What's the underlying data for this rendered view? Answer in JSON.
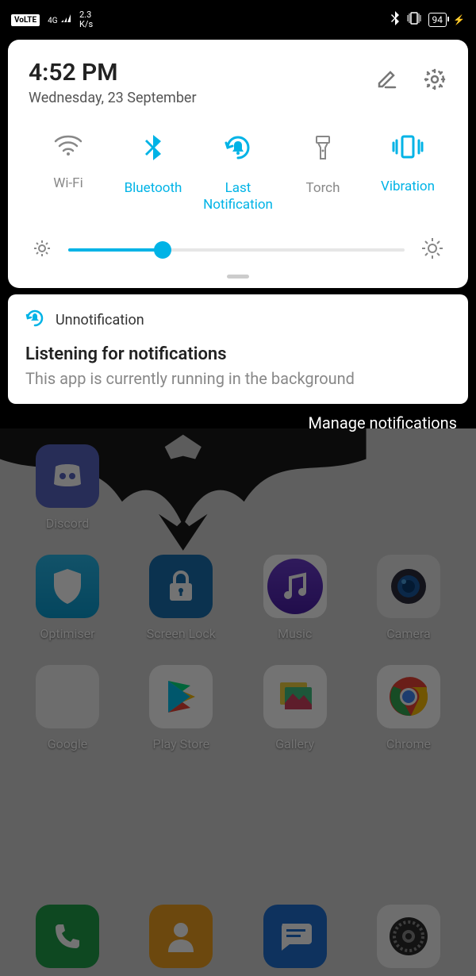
{
  "status": {
    "volte": "VoLTE",
    "network": "4G",
    "speed_top": "2.3",
    "speed_bottom": "K/s",
    "battery": "94"
  },
  "qs": {
    "time": "4:52 PM",
    "date": "Wednesday, 23 September",
    "toggles": {
      "wifi": "Wi-Fi",
      "bluetooth": "Bluetooth",
      "last_notification": "Last Notification",
      "torch": "Torch",
      "vibration": "Vibration"
    },
    "brightness_percent": 28
  },
  "notification": {
    "app": "Unnotification",
    "title": "Listening for notifications",
    "body": "This app is currently running in the background"
  },
  "manage_label": "Manage notifications",
  "apps": {
    "discord": "Discord",
    "optimiser": "Optimiser",
    "screenlock": "Screen Lock",
    "music": "Music",
    "camera": "Camera",
    "google": "Google",
    "playstore": "Play Store",
    "gallery": "Gallery",
    "chrome": "Chrome"
  }
}
